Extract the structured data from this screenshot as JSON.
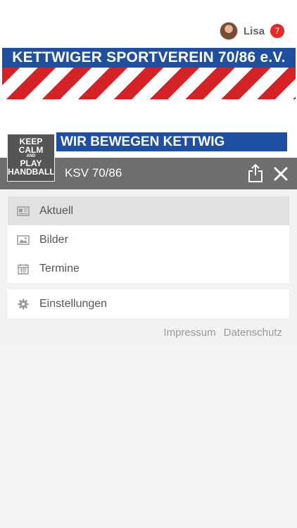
{
  "user": {
    "name": "Lisa",
    "notifications": "7"
  },
  "banner": {
    "club_name": "KETTWIGER SPORTVEREIN 70/86 e.V.",
    "slogan": "WIR BEWEGEN KETTWIG",
    "logo_lines": [
      "KEEP",
      "CALM",
      "AND",
      "PLAY",
      "HANDBALL"
    ]
  },
  "header": {
    "title": "KSV 70/86"
  },
  "menu": {
    "items": [
      {
        "label": "Aktuell",
        "icon": "newspaper-icon",
        "active": true
      },
      {
        "label": "Bilder",
        "icon": "image-icon",
        "active": false
      },
      {
        "label": "Termine",
        "icon": "calendar-icon",
        "active": false
      }
    ],
    "settings": {
      "label": "Einstellungen",
      "icon": "gear-icon"
    }
  },
  "footer": {
    "impressum": "Impressum",
    "datenschutz": "Datenschutz"
  },
  "colors": {
    "brand_blue": "#1e4fa0",
    "brand_red": "#d52226",
    "header_gray": "#6e6e6e",
    "badge_red": "#e32a2a"
  }
}
